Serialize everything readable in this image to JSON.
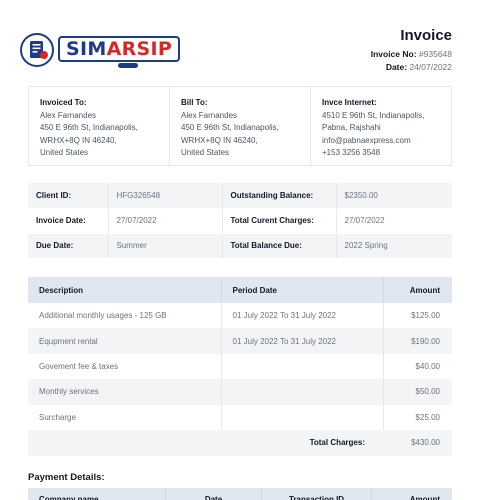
{
  "brand": {
    "part1": "SIM",
    "part2": "ARSIP",
    "colors": {
      "navy": "#1e3a8a",
      "red": "#dc2626"
    }
  },
  "invoice": {
    "title": "Invoice",
    "number_label": "Invoice No:",
    "number": "#935648",
    "date_label": "Date:",
    "date": "24/07/2022"
  },
  "addresses": [
    {
      "heading": "Invoiced To:",
      "lines": [
        "Alex Farnandes",
        "450 E 96th St, Indianapolis,",
        "WRHX+8Q IN 46240,",
        "United States"
      ]
    },
    {
      "heading": "Bill To:",
      "lines": [
        "Alex Farnandes",
        "450 E 96th St, Indianapolis,",
        "WRHX+8Q IN 46240,",
        "United States"
      ]
    },
    {
      "heading": "Invce Internet:",
      "lines": [
        "4510 E 96th St, Indianapolis,",
        "Pabna, Rajshahi",
        "info@pabnaexpress.com",
        "+153 3256 3548"
      ]
    }
  ],
  "info": [
    {
      "k1": "Client ID:",
      "v1": "HFG326548",
      "k2": "Outstanding Balance:",
      "v2": "$2350.00"
    },
    {
      "k1": "Invoice Date:",
      "v1": "27/07/2022",
      "k2": "Total Curent Charges:",
      "v2": "27/07/2022"
    },
    {
      "k1": "Due Date:",
      "v1": "Summer",
      "k2": "Total Balance Due:",
      "v2": "2022 Spring"
    }
  ],
  "items": {
    "headers": {
      "description": "Description",
      "period": "Period Date",
      "amount": "Amount"
    },
    "rows": [
      {
        "description": "Additional monthly usages - 125 GB",
        "period": "01 July 2022 To 31 July 2022",
        "amount": "$125.00"
      },
      {
        "description": "Equpment rental",
        "period": "01 July 2022 To 31 July 2022",
        "amount": "$190.00"
      },
      {
        "description": "Govement fee & taxes",
        "period": "",
        "amount": "$40.00"
      },
      {
        "description": "Monthly services",
        "period": "",
        "amount": "$50.00"
      },
      {
        "description": "Surcharge",
        "period": "",
        "amount": "$25.00"
      }
    ],
    "total_label": "Total Charges:",
    "total_value": "$430.00"
  },
  "payment": {
    "title": "Payment Details:",
    "headers": {
      "company": "Company name",
      "date": "Date",
      "transaction": "Transaction ID",
      "amount": "Amount"
    }
  }
}
